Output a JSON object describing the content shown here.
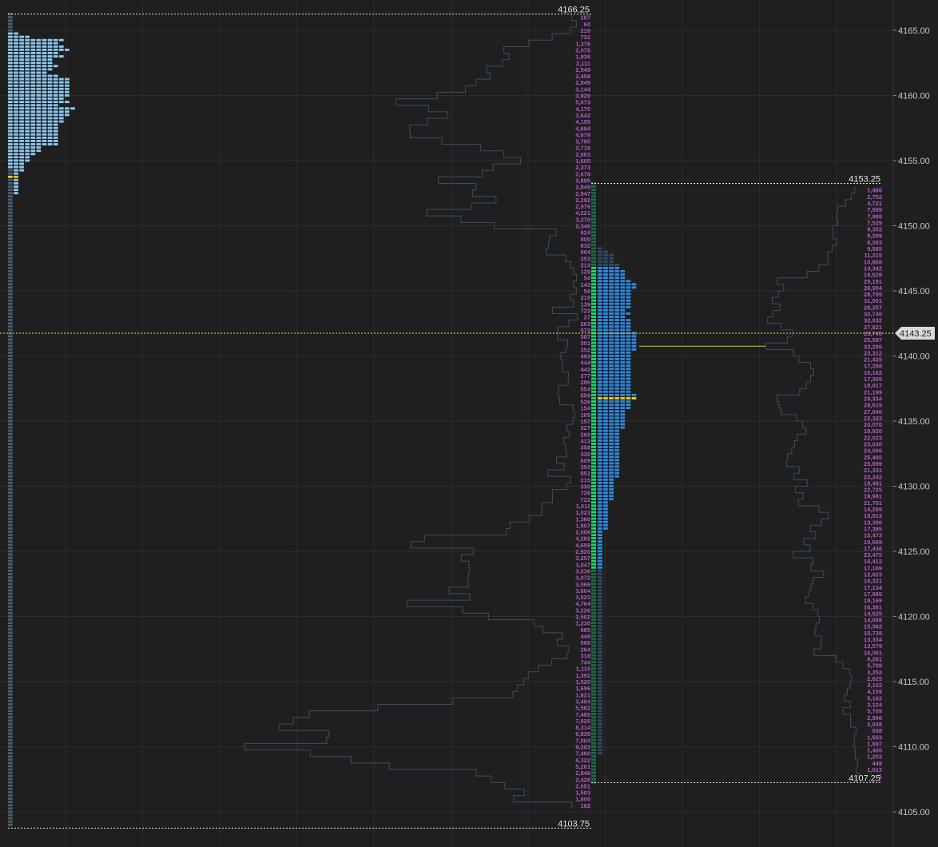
{
  "chart_data": {
    "type": "market-profile",
    "y_axis": {
      "range": [
        4103.25,
        4166.5
      ],
      "tick_step": 5,
      "ticks": [
        "4165.00",
        "4160.00",
        "4155.00",
        "4150.00",
        "4145.00",
        "4140.00",
        "4135.00",
        "4130.00",
        "4125.00",
        "4120.00",
        "4115.00",
        "4110.00",
        "4105.00"
      ],
      "current_price_label": "4143.25",
      "current_price_value": 4141.75
    },
    "grid": true,
    "colors": {
      "background": "#1f1f1f",
      "grid": "#2c2c2c",
      "axis": "#3a3a3a",
      "profile_prior": "#8cc9f0",
      "profile_current": "#2b8be6",
      "profile_outside_va": "#2d4a66",
      "poc": "#f2c81a",
      "single_print": "#4a5d6e",
      "tick_column_green": "#22d66f",
      "tick_column_dark": "#1f6b44",
      "volume_outline": "#35506a",
      "volume_label": "#b35cc7",
      "ref_line": "#e6e6e6",
      "yellow_line": "#d8c21a"
    },
    "reference_lines": [
      {
        "label": "4166.25",
        "price": 4166.25
      },
      {
        "label": "4153.25",
        "price": 4153.25
      },
      {
        "label": "4107.25",
        "price": 4107.25
      },
      {
        "label": "4103.75",
        "price": 4103.75
      }
    ],
    "session1": {
      "start_price": 4103.75,
      "single_print_low": 4103.75,
      "single_print_high": 4166.25,
      "poc_price": 4153.75,
      "counts_from_top": [
        2,
        4,
        10,
        9,
        10,
        11,
        9,
        10,
        8,
        8,
        9,
        8,
        7,
        9,
        11,
        11,
        11,
        11,
        11,
        11,
        10,
        11,
        9,
        12,
        11,
        11,
        10,
        10,
        9,
        9,
        9,
        9,
        9,
        9,
        9,
        6,
        6,
        5,
        4,
        4,
        3,
        3,
        3,
        2,
        2,
        2,
        2,
        2,
        2,
        2
      ]
    },
    "session2": {
      "price_high": 4153.25,
      "price_low": 4107.25,
      "poc_price": 4136.75,
      "value_area_high": 4146.75,
      "value_area_low": 4123.75,
      "counts_from_high": [
        0,
        0,
        0,
        0,
        0,
        0,
        0,
        0,
        0,
        0,
        0,
        0,
        0,
        0,
        0,
        0,
        0,
        0,
        0,
        0,
        1,
        2,
        3,
        3,
        3,
        4,
        4,
        5,
        5,
        5,
        6,
        7,
        7,
        6,
        6,
        6,
        6,
        6,
        6,
        5,
        6,
        5,
        6,
        6,
        6,
        6,
        7,
        7,
        7,
        7,
        7,
        7,
        6,
        6,
        6,
        6,
        6,
        6,
        6,
        6,
        6,
        6,
        6,
        6,
        6,
        7,
        7,
        6,
        6,
        6,
        5,
        5,
        5,
        5,
        5,
        5,
        4,
        4,
        4,
        4,
        4,
        4,
        4,
        4,
        4,
        4,
        4,
        4,
        4,
        4,
        4,
        3,
        3,
        3,
        3,
        3,
        3,
        3,
        2,
        2,
        2,
        2,
        2,
        2,
        2,
        2,
        2,
        1,
        1,
        1,
        1,
        1,
        1,
        1,
        1,
        1,
        1,
        1,
        1,
        1,
        1,
        1,
        1,
        1,
        1,
        1,
        1,
        1,
        1,
        1,
        1,
        1,
        1,
        1,
        1,
        1,
        1,
        1,
        1,
        1,
        1,
        1,
        1,
        1,
        1,
        1,
        1,
        1,
        1,
        1,
        1,
        1,
        1,
        1,
        1,
        1,
        1,
        1,
        1,
        1,
        1,
        1,
        1,
        1,
        1,
        1,
        1,
        1,
        1,
        1,
        1,
        1,
        1,
        1,
        1,
        1
      ]
    },
    "volume_labels_left": [
      "187",
      "60",
      "216",
      "731",
      "1,376",
      "2,075",
      "1,936",
      "2,111",
      "2,549",
      "2,458",
      "2,849",
      "3,144",
      "3,929",
      "5,073",
      "4,170",
      "3,642",
      "4,195",
      "4,694",
      "4,679",
      "3,795",
      "2,718",
      "2,083",
      "1,605",
      "2,373",
      "2,678",
      "3,895",
      "2,849",
      "2,947",
      "2,292",
      "2,976",
      "4,221",
      "3,270",
      "2,346",
      "624",
      "800",
      "832",
      "904",
      "353",
      "213",
      "129",
      "54",
      "143",
      "59",
      "219",
      "139",
      "723",
      "27",
      "263",
      "573",
      "587",
      "301",
      "352",
      "493",
      "444",
      "443",
      "277",
      "286",
      "554",
      "559",
      "526",
      "154",
      "105",
      "157",
      "327",
      "260",
      "413",
      "358",
      "330",
      "609",
      "393",
      "851",
      "215",
      "330",
      "726",
      "722",
      "1,011",
      "1,023",
      "1,360",
      "1,907",
      "2,006",
      "4,282",
      "4,659",
      "2,920",
      "3,257",
      "3,047",
      "3,036",
      "3,072",
      "3,069",
      "3,604",
      "3,023",
      "4,764",
      "3,226",
      "2,502",
      "1,230",
      "985",
      "449",
      "588",
      "264",
      "318",
      "744",
      "1,115",
      "1,392",
      "1,520",
      "1,696",
      "1,821",
      "3,494",
      "5,582",
      "7,485",
      "7,926",
      "8,314",
      "6,939",
      "7,004",
      "9,283",
      "7,460",
      "6,322",
      "5,261",
      "2,846",
      "2,428",
      "2,051",
      "1,503",
      "1,800",
      "182"
    ],
    "volume_labels_right": [
      "1,486",
      "2,752",
      "4,721",
      "7,599",
      "7,988",
      "7,529",
      "9,352",
      "9,299",
      "8,083",
      "9,585",
      "11,215",
      "10,868",
      "14,342",
      "18,528",
      "29,191",
      "26,904",
      "28,795",
      "31,001",
      "28,257",
      "30,740",
      "32,632",
      "27,821",
      "23,745",
      "25,597",
      "33,286",
      "23,312",
      "21,425",
      "17,288",
      "16,162",
      "17,305",
      "18,817",
      "21,199",
      "29,334",
      "28,619",
      "27,840",
      "22,323",
      "20,070",
      "18,920",
      "22,023",
      "23,030",
      "24,006",
      "25,495",
      "25,899",
      "21,331",
      "23,242",
      "18,491",
      "22,725",
      "19,981",
      "21,701",
      "14,295",
      "10,913",
      "13,396",
      "17,385",
      "15,473",
      "19,669",
      "17,436",
      "23,475",
      "16,412",
      "17,169",
      "12,623",
      "16,321",
      "17,134",
      "17,885",
      "19,169",
      "16,381",
      "14,625",
      "14,098",
      "15,362",
      "15,738",
      "13,334",
      "13,579",
      "16,061",
      "8,281",
      "5,708",
      "3,252",
      "2,625",
      "3,102",
      "4,159",
      "5,162",
      "3,124",
      "5,709",
      "2,996",
      "2,938",
      "938",
      "1,553",
      "1,697",
      "1,400",
      "1,253",
      "449",
      "1,013",
      "1"
    ]
  }
}
